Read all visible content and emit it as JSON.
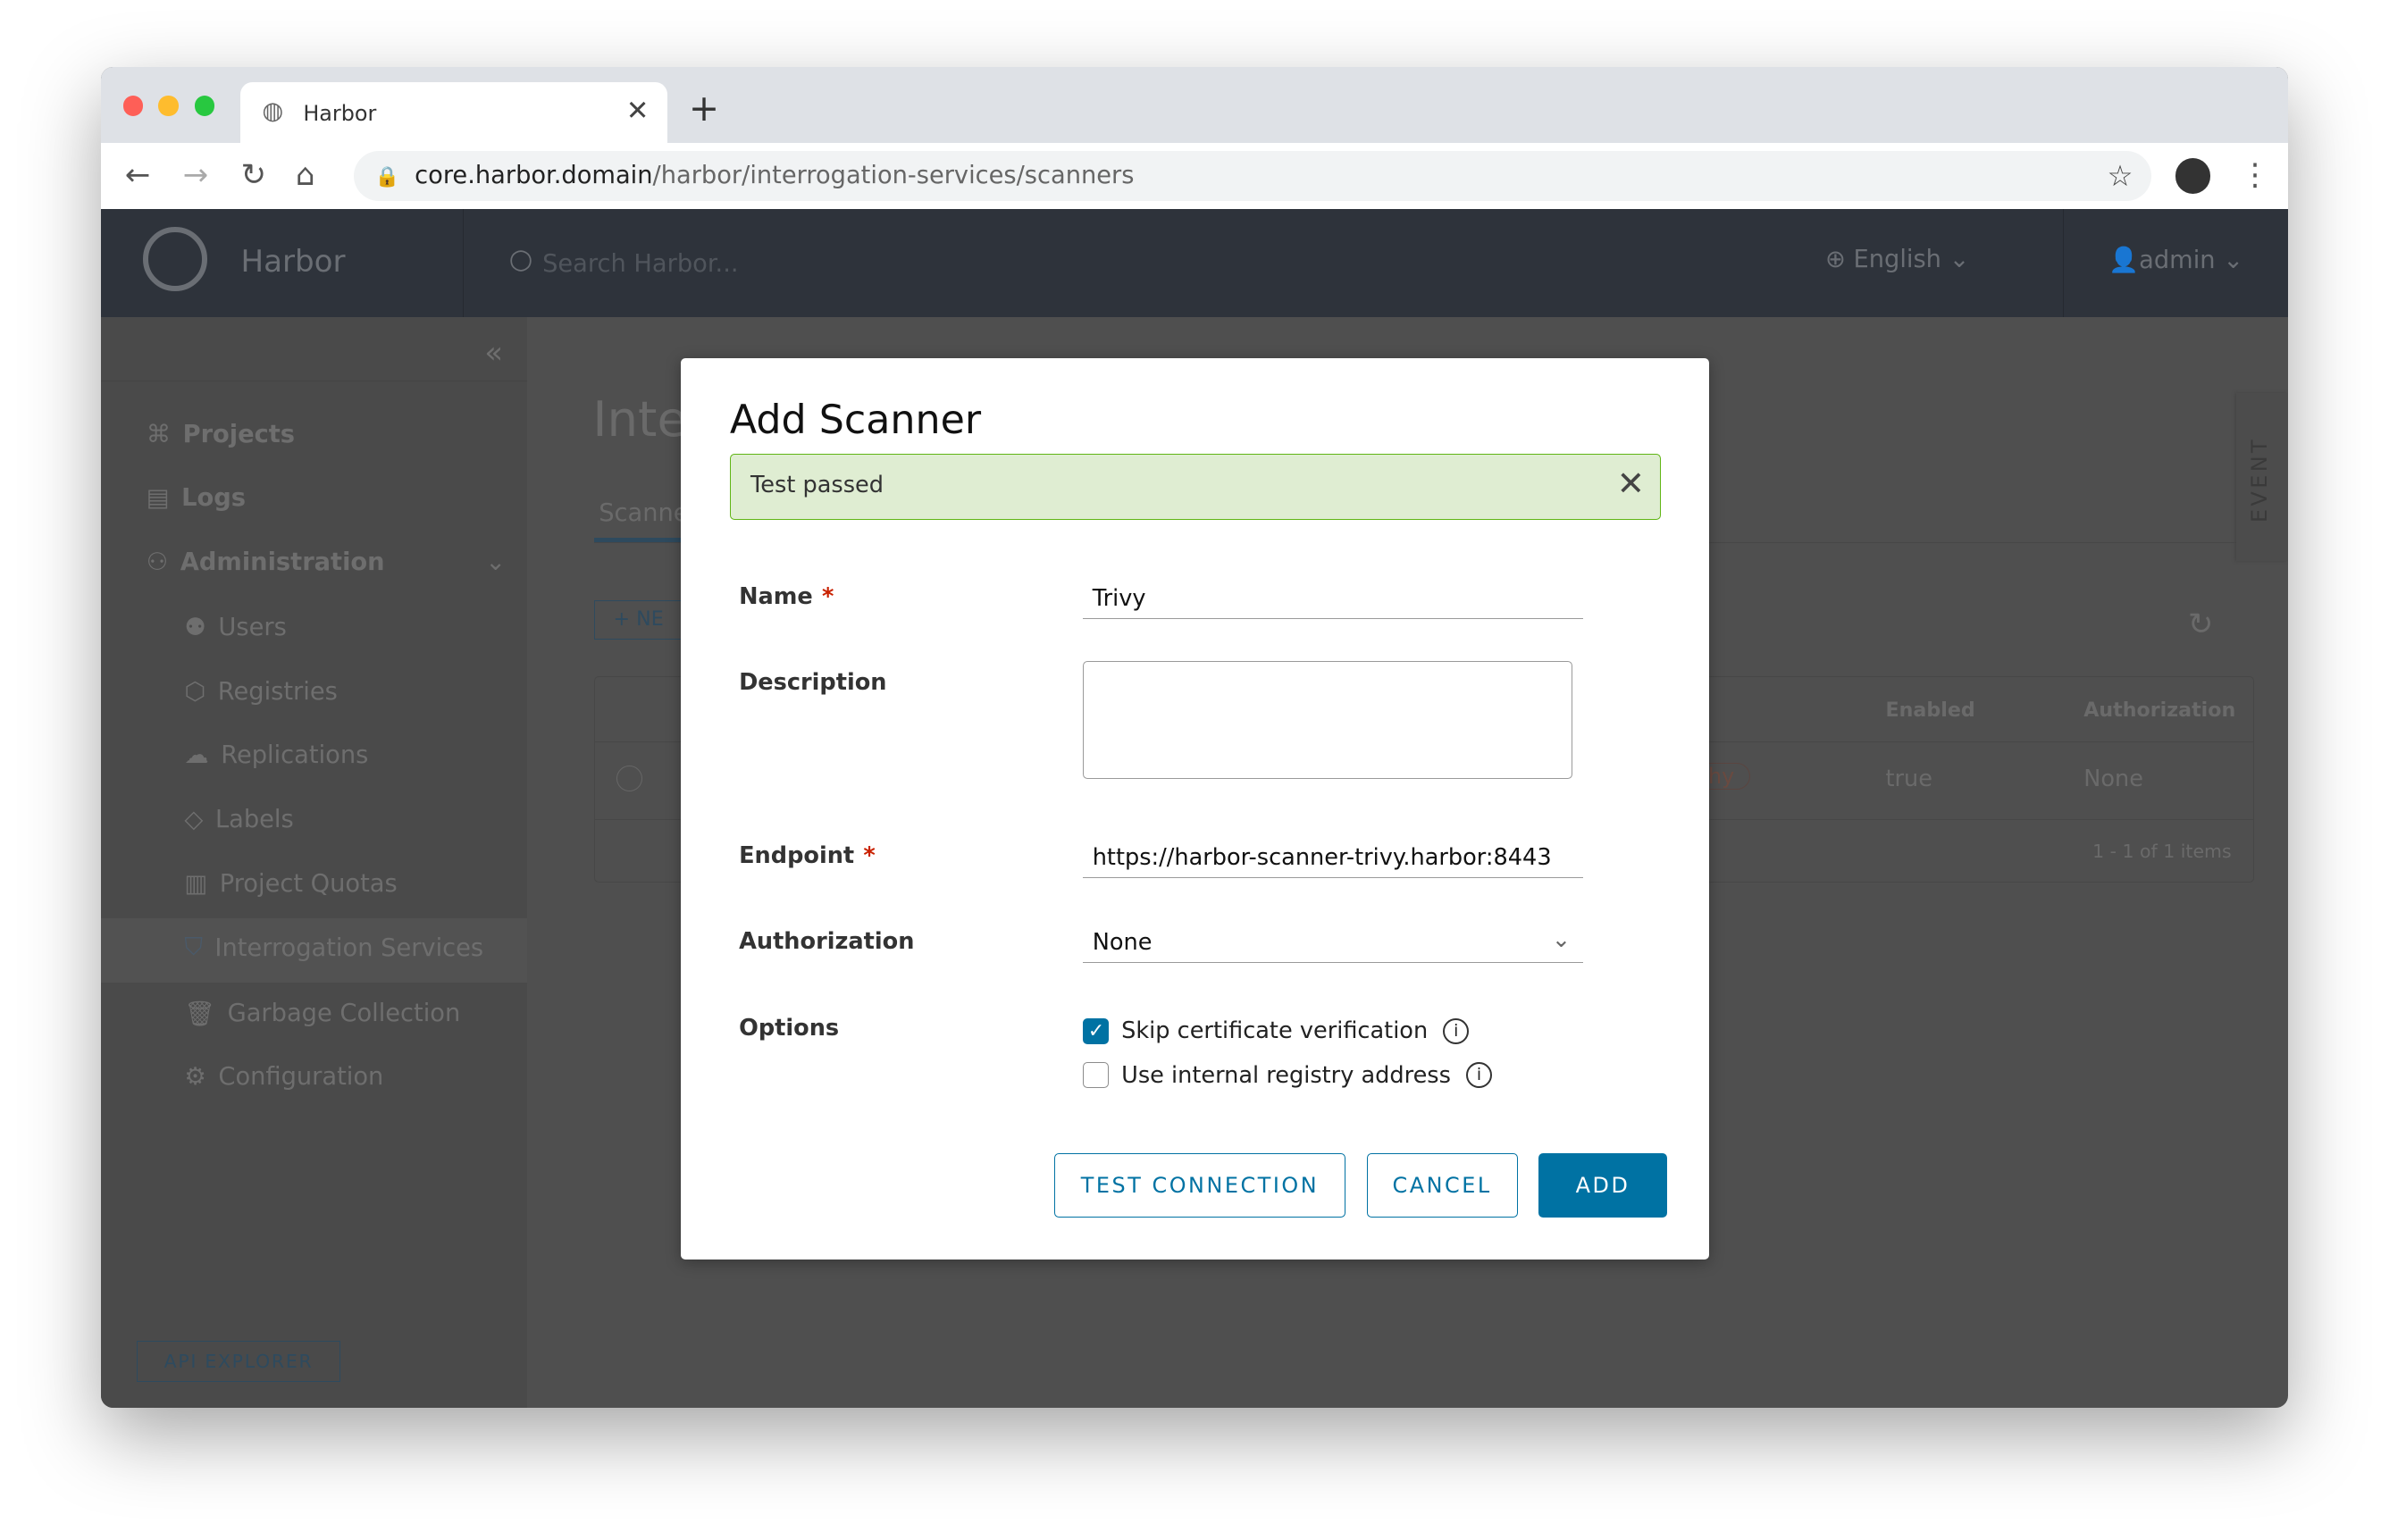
{
  "browser": {
    "tab_title": "Harbor",
    "url_host": "core.harbor.domain",
    "url_path": "/harbor/interrogation-services/scanners"
  },
  "header": {
    "brand": "Harbor",
    "search_placeholder": "Search Harbor...",
    "language": "English",
    "user": "admin"
  },
  "sidebar": {
    "items": [
      {
        "label": "Projects",
        "icon": "projects-icon"
      },
      {
        "label": "Logs",
        "icon": "logs-icon"
      },
      {
        "label": "Administration",
        "icon": "administration-icon"
      },
      {
        "label": "Users",
        "icon": "users-icon"
      },
      {
        "label": "Registries",
        "icon": "registries-icon"
      },
      {
        "label": "Replications",
        "icon": "replications-icon"
      },
      {
        "label": "Labels",
        "icon": "labels-icon"
      },
      {
        "label": "Project Quotas",
        "icon": "quotas-icon"
      },
      {
        "label": "Interrogation Services",
        "icon": "shield-icon"
      },
      {
        "label": "Garbage Collection",
        "icon": "trash-icon"
      },
      {
        "label": "Configuration",
        "icon": "gear-icon"
      }
    ],
    "api_explorer": "API EXPLORER"
  },
  "main": {
    "title_partial": "Inte",
    "tab_partial": "Scanne",
    "new_partial": "+ NE",
    "columns": [
      "Enabled",
      "Authorization"
    ],
    "row": {
      "badge_partial": "hy",
      "enabled": "true",
      "authorization": "None"
    },
    "pagination": "1 - 1 of 1 items",
    "event_tab": "EVENT"
  },
  "modal": {
    "title": "Add Scanner",
    "alert": "Test passed",
    "name_label": "Name",
    "name_value": "Trivy",
    "description_label": "Description",
    "description_value": "",
    "endpoint_label": "Endpoint",
    "endpoint_value": "https://harbor-scanner-trivy.harbor:8443",
    "authorization_label": "Authorization",
    "authorization_value": "None",
    "options_label": "Options",
    "options": [
      {
        "label": "Skip certificate verification",
        "checked": true
      },
      {
        "label": "Use internal registry address",
        "checked": false
      }
    ],
    "test_button": "TEST CONNECTION",
    "cancel_button": "CANCEL",
    "add_button": "ADD"
  }
}
